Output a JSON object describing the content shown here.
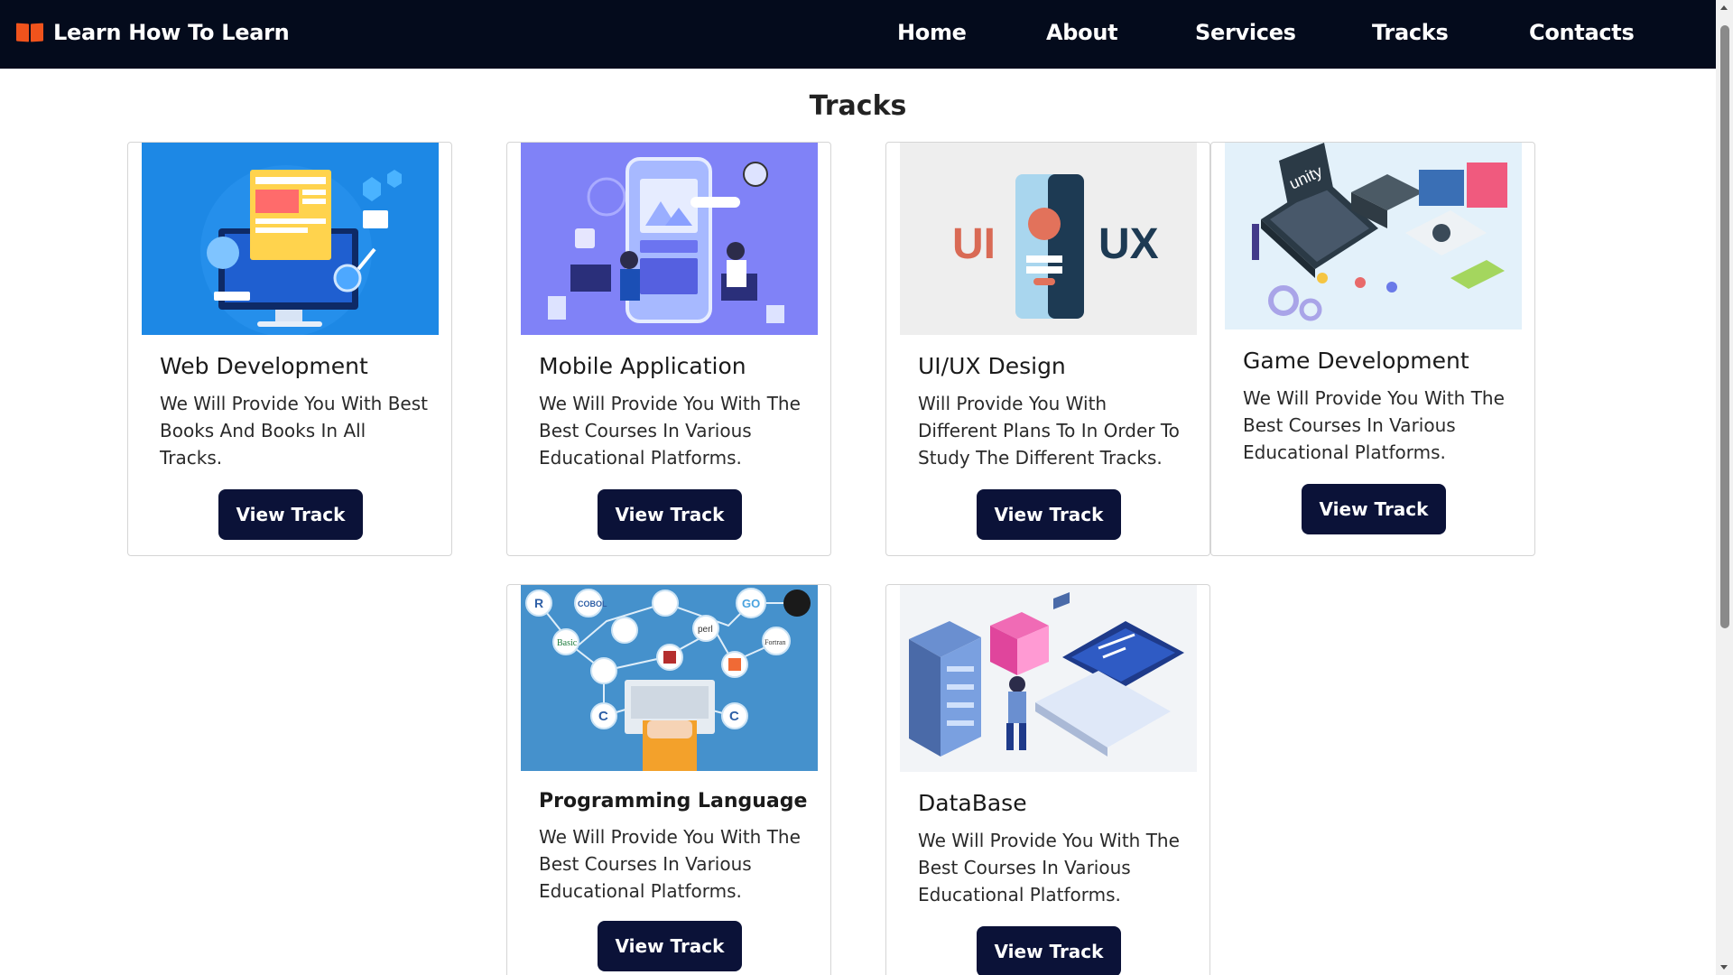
{
  "brand": {
    "name": "Learn How To Learn",
    "icon": "open-book-icon",
    "icon_color": "#f0531c"
  },
  "nav": {
    "background": "#040b1c",
    "links": [
      "Home",
      "About",
      "Services",
      "Tracks",
      "Contacts"
    ]
  },
  "section": {
    "title": "Tracks"
  },
  "button_color": "#0b1238",
  "cards": [
    {
      "title": "Web Development",
      "text": "We Will Provide You With Best Books And Books In All Tracks.",
      "button": "View Track",
      "image": "web-development-illustration"
    },
    {
      "title": "Mobile Application",
      "text": "We Will Provide You With The Best Courses In Various Educational Platforms.",
      "button": "View Track",
      "image": "mobile-application-illustration"
    },
    {
      "title": "UI/UX Design",
      "text": "Will Provide You With Different Plans To In Order To Study The Different Tracks.",
      "button": "View Track",
      "image": "ui-ux-illustration",
      "image_labels": [
        "UI",
        "UX"
      ]
    },
    {
      "title": "Game Development",
      "text": "We Will Provide You With The Best Courses In Various Educational Platforms.",
      "button": "View Track",
      "image": "game-development-illustration",
      "image_labels": [
        "unity"
      ]
    },
    {
      "title": "Programming Language",
      "text": "We Will Provide You With The Best Courses In Various Educational Platforms.",
      "button": "View Track",
      "image": "programming-languages-illustration",
      "image_labels": [
        "R",
        "COBOL",
        "GO",
        "Basic",
        "perl",
        "Fortran",
        "C",
        "C"
      ]
    },
    {
      "title": "DataBase",
      "text": "We Will Provide You With The Best Courses In Various Educational Platforms.",
      "button": "View Track",
      "image": "database-illustration"
    }
  ]
}
